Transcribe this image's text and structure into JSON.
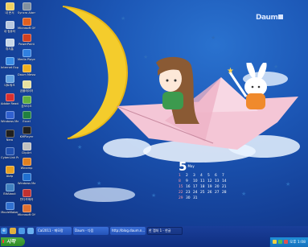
{
  "desktop": {
    "logo": "Daum",
    "icons_col1": [
      {
        "label": "내 문서",
        "color": "#f0d060"
      },
      {
        "label": "내 컴퓨터",
        "color": "#b8c8e0"
      },
      {
        "label": "휴지통",
        "color": "#c8d8e8"
      },
      {
        "label": "Internet Explorer",
        "color": "#3a8ee8"
      },
      {
        "label": "네트워크",
        "color": "#60a0e0"
      },
      {
        "label": "Adobe Reader 9",
        "color": "#d83030"
      },
      {
        "label": "Windows Media",
        "color": "#3060d0"
      },
      {
        "label": "Nero",
        "color": "#202020"
      },
      {
        "label": "CyberLink PowerDVD",
        "color": "#2050b0"
      },
      {
        "label": "Alzip",
        "color": "#e8a020"
      },
      {
        "label": "BitAbout",
        "color": "#4080c0"
      },
      {
        "label": "MovieMaker",
        "color": "#3070d0"
      }
    ],
    "icons_col2": [
      {
        "label": "Syncro Alarm",
        "color": "#8090a0"
      },
      {
        "label": "Microsoft Office",
        "color": "#e06020"
      },
      {
        "label": "PowerPoint",
        "color": "#d04020"
      },
      {
        "label": "Media Player",
        "color": "#3080e0"
      },
      {
        "label": "Daum Messenger",
        "color": "#f0b020"
      },
      {
        "label": "곰플레이어",
        "color": "#e8e0a0"
      },
      {
        "label": "곰오디오",
        "color": "#60b040"
      },
      {
        "label": "Excel",
        "color": "#208040"
      },
      {
        "label": "KMPlayer",
        "color": "#202020"
      },
      {
        "label": "ClipArt",
        "color": "#c0c0c0"
      },
      {
        "label": "Winamp",
        "color": "#e08020"
      },
      {
        "label": "Windows Mail",
        "color": "#2070d0"
      },
      {
        "label": "반디카메라",
        "color": "#c03030"
      },
      {
        "label": "Microsoft Office 2007",
        "color": "#e07030"
      }
    ],
    "calendar": {
      "month": "5",
      "month_label": "May",
      "days": [
        "1",
        "2",
        "3",
        "4",
        "5",
        "6",
        "7",
        "8",
        "9",
        "10",
        "11",
        "12",
        "13",
        "14",
        "15",
        "16",
        "17",
        "18",
        "19",
        "20",
        "21",
        "22",
        "23",
        "24",
        "25",
        "26",
        "27",
        "28",
        "29",
        "30",
        "31"
      ],
      "sunday_color": "#ff9aa8"
    }
  },
  "taskbar": {
    "start_label": "시작",
    "quick_launch": [
      "ie-icon",
      "explorer-icon",
      "media-icon",
      "desktop-icon"
    ],
    "tasks": [
      {
        "label": "Cal2011 - 메모장",
        "active": false
      },
      {
        "label": "Daum - 다음",
        "active": false
      },
      {
        "label": "http://blog.daum.n...",
        "active": false
      },
      {
        "label": "한 캡처 1 - 한글",
        "active": true
      }
    ],
    "clock": "오후 1:08"
  }
}
